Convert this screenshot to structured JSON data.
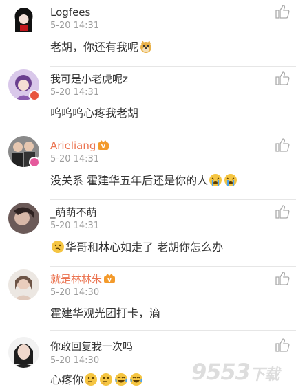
{
  "comments": [
    {
      "name": "Logfees",
      "time": "5-20 14:31",
      "text": "老胡，你还有我呢",
      "emoji": "doge-icon"
    },
    {
      "name": "我可是小老虎呢z",
      "time": "5-20 14:31",
      "text": "呜呜呜心疼我老胡"
    },
    {
      "name": "Arieliang",
      "time": "5-20 14:31",
      "text": "没关系 霍建华五年后还是你的人",
      "emoji": "crying-icon"
    },
    {
      "name": "_萌萌不萌",
      "time": "5-20 14:31",
      "text": "华哥和林心如走了 老胡你怎么办",
      "emoji": "hmm-icon"
    },
    {
      "name": "就是林林朱",
      "time": "5-20 14:30",
      "text": "霍建华观光团打卡，滴"
    },
    {
      "name": "你敢回复我一次吗",
      "time": "5-20 14:30",
      "text": "心疼你"
    }
  ],
  "watermark": {
    "main": "9553",
    "sub": "下载"
  },
  "colors": {
    "vip_name": "#eb7350",
    "time": "#9b9b9b",
    "divider": "#e6e6e6"
  }
}
